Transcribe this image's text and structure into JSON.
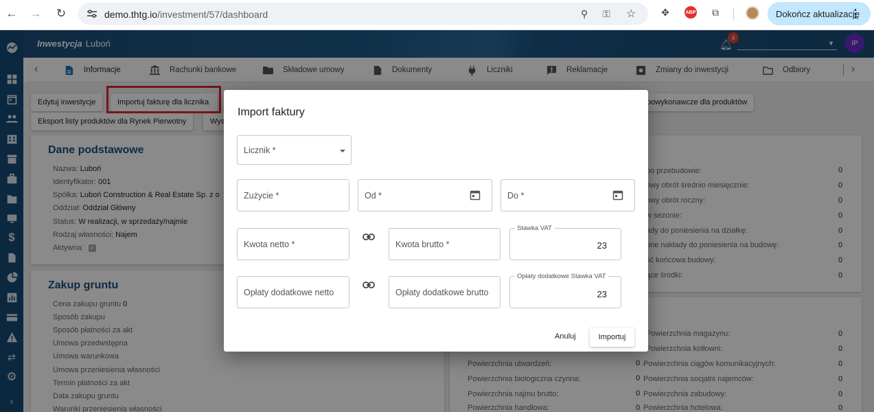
{
  "browser": {
    "url_host": "demo.thtg.io",
    "url_path": "/investment/57/dashboard",
    "update_button": "Dokończ aktualizację",
    "abp_label": "ABP"
  },
  "header": {
    "title_italic": "Inwestycja",
    "title_name": "Luboń",
    "notification_count": "4",
    "user_initials": "IP"
  },
  "tabs": [
    {
      "label": "Informacje",
      "icon": "document-icon"
    },
    {
      "label": "Rachunki bankowe",
      "icon": "bank-icon"
    },
    {
      "label": "Składowe umowy",
      "icon": "folder-icon"
    },
    {
      "label": "Dokumenty",
      "icon": "file-icon"
    },
    {
      "label": "Liczniki",
      "icon": "plug-icon"
    },
    {
      "label": "Reklamacje",
      "icon": "report-icon"
    },
    {
      "label": "Zmiany do inwestycji",
      "icon": "settings-box-icon"
    },
    {
      "label": "Odbiory",
      "icon": "folder-outline-icon"
    }
  ],
  "actions": {
    "edit": "Edytuj inwestycje",
    "import_invoice": "Importuj fakturę dla licznika",
    "export_products": "Eksport listy produktów dla Rynek Pierwotny",
    "partial_button": "Wys",
    "partial_right_button": "powykonawcze dla produktów"
  },
  "basic_data": {
    "title": "Dane podstawowe",
    "rows": [
      {
        "label": "Nazwa:",
        "value": "Luboń"
      },
      {
        "label": "Identyfikator:",
        "value": "001"
      },
      {
        "label": "Spółka:",
        "value": "Luboń Construction & Real Estate Sp. z o"
      },
      {
        "label": "Oddział:",
        "value": "Oddział Główny"
      },
      {
        "label": "Status:",
        "value": "W realizacji, w sprzedaży/najmie"
      },
      {
        "label": "Rodzaj własności:",
        "value": "Najem"
      },
      {
        "label": "Aktywna:",
        "value": "✓"
      }
    ]
  },
  "land_purchase": {
    "title": "Zakup gruntu",
    "rows": [
      {
        "label": "Cena zakupu gruntu",
        "value": "0"
      },
      {
        "label": "Sposób zakupu",
        "value": ""
      },
      {
        "label": "Sposób płatności za akt",
        "value": ""
      },
      {
        "label": "Umowa przedwstępna",
        "value": ""
      },
      {
        "label": "Umowa warunkowa",
        "value": ""
      },
      {
        "label": "Umowa przeniesienia własności",
        "value": ""
      },
      {
        "label": "Termin płatności za akt",
        "value": ""
      },
      {
        "label": "Data zakupu gruntu",
        "value": ""
      },
      {
        "label": "Warunki przeniesienia własności",
        "value": ""
      }
    ]
  },
  "right_card_1": {
    "rows": [
      {
        "label": "po przebudowie:",
        "value": "0"
      },
      {
        "label": "owy obrót średnio miesięcznie:",
        "value": "0"
      },
      {
        "label": "owy obrót roczny:",
        "value": "0"
      },
      {
        "label": "w sezonie:",
        "value": "0"
      },
      {
        "label": "ady do poniesienia na działkę:",
        "value": "0"
      },
      {
        "label": "one nakłady do poniesienia na budowę:",
        "value": "0"
      },
      {
        "label": "ść końcowa budowy:",
        "value": "0"
      },
      {
        "label": "ące środki:",
        "value": "0"
      }
    ]
  },
  "right_card_2": {
    "right_rows": [
      {
        "label": "Powierzchnia magazynu:",
        "value": "0"
      },
      {
        "label": "Powierzchnia kotłowni:",
        "value": "0"
      },
      {
        "label": "Powierzchnia ciągów komunikacyjnych:",
        "value": "0"
      },
      {
        "label": "Powierzchnia socjalni najemców:",
        "value": "0"
      },
      {
        "label": "Powierzchnia zabudowy:",
        "value": "0"
      },
      {
        "label": "Powierzchnia hotelowa:",
        "value": "0"
      }
    ],
    "left_rows": [
      {
        "label": "Powierzchnia utwardzeń:",
        "value": "0"
      },
      {
        "label": "Powierzchnia biologiczna czynna:",
        "value": "0"
      },
      {
        "label": "Powierzchnia najmu brutto:",
        "value": "0"
      },
      {
        "label": "Powierzchnia handlowa:",
        "value": "0"
      }
    ]
  },
  "modal": {
    "title": "Import faktury",
    "meter_label": "Licznik *",
    "usage_label": "Zużycie *",
    "from_label": "Od *",
    "to_label": "Do *",
    "net_amount_label": "Kwota netto *",
    "gross_amount_label": "Kwota brutto *",
    "vat_label": "Stawka VAT",
    "vat_value": "23",
    "extra_net_label": "Opłaty dodatkowe netto",
    "extra_gross_label": "Opłaty dodatkowe brutto",
    "extra_vat_label": "Opłaty dodatkowe Stawka VAT",
    "extra_vat_value": "23",
    "cancel": "Anuluj",
    "import": "Importuj"
  }
}
